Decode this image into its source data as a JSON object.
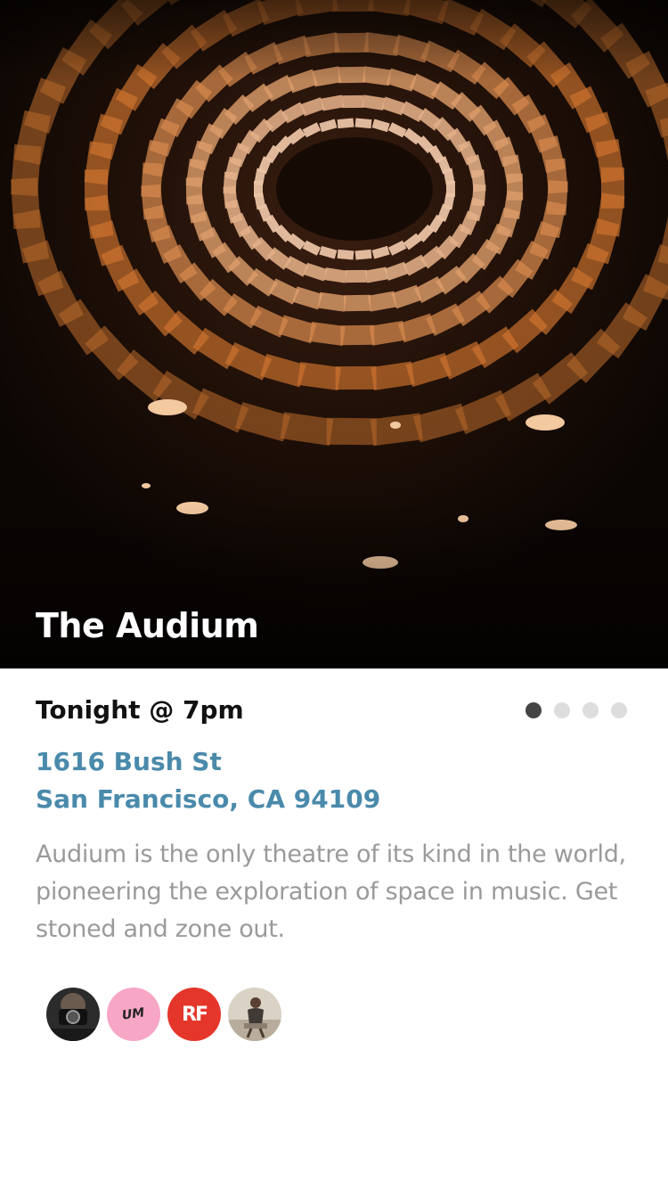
{
  "event": {
    "venue_name": "The Audium",
    "when": "Tonight @ 7pm",
    "address_line1": "1616 Bush St",
    "address_line2": "San Francisco, CA 94109",
    "description": "Audium is the only theatre of its kind in the world, pioneering the exploration of space in music. Get stoned and zone out."
  },
  "pager": {
    "total": 4,
    "active_index": 0
  },
  "attendees": [
    {
      "name": "photographer-avatar",
      "label": ""
    },
    {
      "name": "um-logo-avatar",
      "label": "UM"
    },
    {
      "name": "rf-logo-avatar",
      "label": "RF"
    },
    {
      "name": "person-avatar",
      "label": ""
    }
  ],
  "colors": {
    "address": "#4a8aab",
    "description": "#9a9a9a",
    "title": "#111111",
    "dot_active": "#444444",
    "dot_inactive": "#dddddd",
    "rf_red": "#e5362b",
    "um_pink": "#f7a6c6"
  }
}
